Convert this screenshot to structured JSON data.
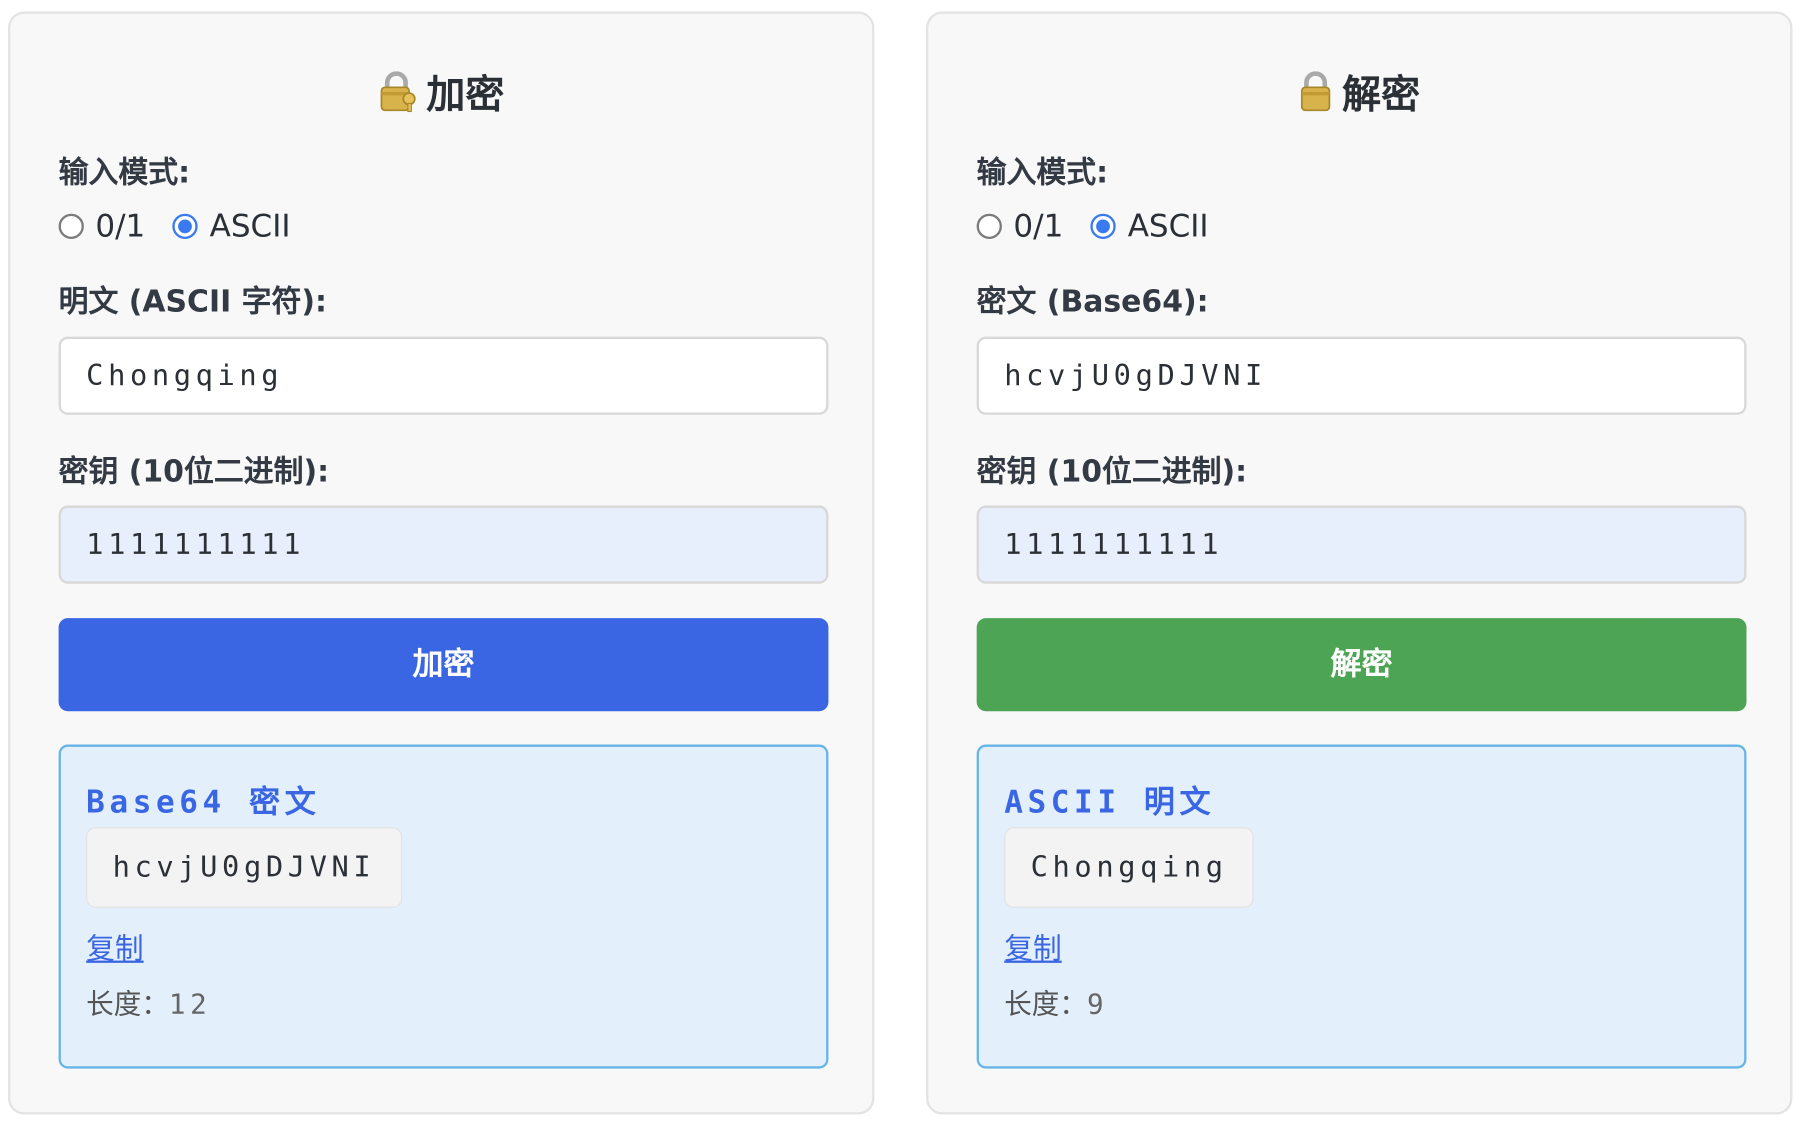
{
  "encrypt": {
    "title": "加密",
    "icon": "locked-with-key-icon",
    "mode_label": "输入模式:",
    "mode_options": [
      "0/1",
      "ASCII"
    ],
    "mode_selected": "ASCII",
    "input_label": "明文 (ASCII 字符):",
    "input_value": "Chongqing",
    "key_label": "密钥 (10位二进制):",
    "key_value": "1111111111",
    "button_label": "加密",
    "button_color": "#3a66e3",
    "result_title": "Base64 密文",
    "result_value": "hcvjU0gDJVNI",
    "copy_label": "复制",
    "length_label": "长度：",
    "length_value": "12"
  },
  "decrypt": {
    "title": "解密",
    "icon": "lock-icon",
    "mode_label": "输入模式:",
    "mode_options": [
      "0/1",
      "ASCII"
    ],
    "mode_selected": "ASCII",
    "input_label": "密文 (Base64):",
    "input_value": "hcvjU0gDJVNI",
    "key_label": "密钥 (10位二进制):",
    "key_value": "1111111111",
    "button_label": "解密",
    "button_color": "#4ea455",
    "result_title": "ASCII 明文",
    "result_value": "Chongqing",
    "copy_label": "复制",
    "length_label": "长度：",
    "length_value": "9"
  }
}
